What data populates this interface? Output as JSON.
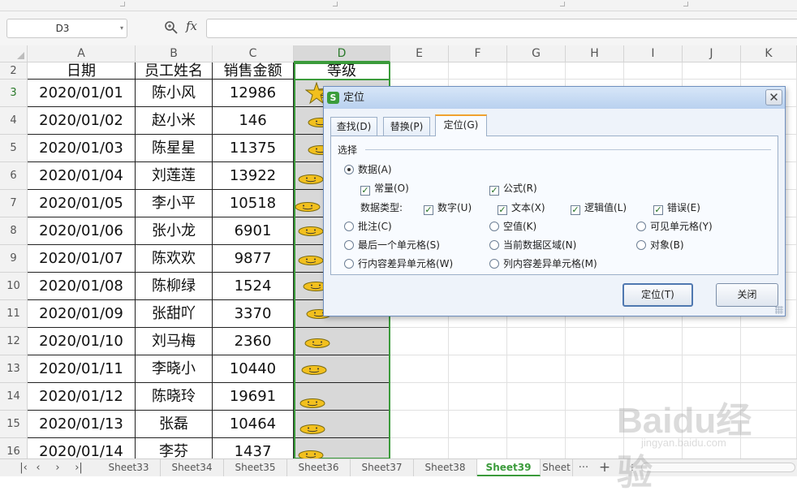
{
  "formula_bar": {
    "name_box": "D3",
    "fx_label": "fx",
    "formula_value": ""
  },
  "columns": [
    "A",
    "B",
    "C",
    "D",
    "E",
    "F",
    "G",
    "H",
    "I",
    "J",
    "K"
  ],
  "selected_column": "D",
  "header_row": {
    "row": "2",
    "date": "日期",
    "name": "员工姓名",
    "amount": "销售金额",
    "grade": "等级"
  },
  "rows": [
    {
      "row": "3",
      "date": "2020/01/01",
      "name": "陈小风",
      "amount": "12986"
    },
    {
      "row": "4",
      "date": "2020/01/02",
      "name": "赵小米",
      "amount": "146"
    },
    {
      "row": "5",
      "date": "2020/01/03",
      "name": "陈星星",
      "amount": "11375"
    },
    {
      "row": "6",
      "date": "2020/01/04",
      "name": "刘莲莲",
      "amount": "13922"
    },
    {
      "row": "7",
      "date": "2020/01/05",
      "name": "李小平",
      "amount": "10518"
    },
    {
      "row": "8",
      "date": "2020/01/06",
      "name": "张小龙",
      "amount": "6901"
    },
    {
      "row": "9",
      "date": "2020/01/07",
      "name": "陈欢欢",
      "amount": "9877"
    },
    {
      "row": "10",
      "date": "2020/01/08",
      "name": "陈柳绿",
      "amount": "1524"
    },
    {
      "row": "11",
      "date": "2020/01/09",
      "name": "张甜吖",
      "amount": "3370"
    },
    {
      "row": "12",
      "date": "2020/01/10",
      "name": "刘马梅",
      "amount": "2360"
    },
    {
      "row": "13",
      "date": "2020/01/11",
      "name": "李晓小",
      "amount": "10440"
    },
    {
      "row": "14",
      "date": "2020/01/12",
      "name": "陈晓玲",
      "amount": "19691"
    },
    {
      "row": "15",
      "date": "2020/01/13",
      "name": "张磊",
      "amount": "10464"
    },
    {
      "row": "16",
      "date": "2020/01/14",
      "name": "李芬",
      "amount": "1437"
    }
  ],
  "dialog": {
    "title": "定位",
    "app_icon": "S",
    "tabs": [
      {
        "label": "查找(D)"
      },
      {
        "label": "替换(P)"
      },
      {
        "label": "定位(G)"
      }
    ],
    "active_tab": "定位(G)",
    "group_label": "选择",
    "opt_data": "数据(A)",
    "opt_const": "常量(O)",
    "opt_formula": "公式(R)",
    "data_type_label": "数据类型:",
    "type_number": "数字(U)",
    "type_text": "文本(X)",
    "type_logical": "逻辑值(L)",
    "type_error": "错误(E)",
    "opt_comment": "批注(C)",
    "opt_blank": "空值(K)",
    "opt_visible": "可见单元格(Y)",
    "opt_last": "最后一个单元格(S)",
    "opt_region": "当前数据区域(N)",
    "opt_object": "对象(B)",
    "opt_rowdiff": "行内容差异单元格(W)",
    "opt_coldiff": "列内容差异单元格(M)",
    "btn_locate": "定位(T)",
    "btn_close": "关闭",
    "close_glyph": "✕"
  },
  "sheet_tabs": [
    "Sheet33",
    "Sheet34",
    "Sheet35",
    "Sheet36",
    "Sheet37",
    "Sheet38",
    "Sheet39",
    "Sheet"
  ],
  "active_sheet": "Sheet39",
  "sheetbar": {
    "more": "···",
    "add": "+"
  },
  "watermark": {
    "text": "Baidu经验",
    "sub": "jingyan.baidu.com"
  },
  "colors": {
    "accent_green": "#3b9b3b",
    "selection_gray": "#d8d8d8",
    "dialog_bg": "#eef3fa",
    "tab_accent": "#f0a22e"
  },
  "icons": [
    "zoom-icon",
    "fx-icon",
    "smiley-icon",
    "close-icon",
    "app-icon"
  ]
}
